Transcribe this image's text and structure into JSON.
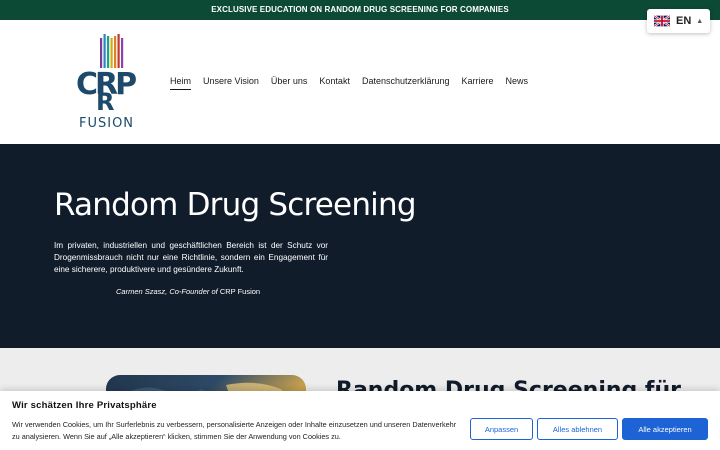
{
  "topbar": {
    "text": "EXCLUSIVE EDUCATION ON RANDOM DRUG SCREENING FOR COMPANIES"
  },
  "language": {
    "code": "EN",
    "flag_icon": "uk-flag-icon"
  },
  "logo": {
    "text": "CRP FUSION",
    "brand_color": "#1d4a6b"
  },
  "nav": {
    "items": [
      {
        "label": "Heim"
      },
      {
        "label": "Unsere Vision"
      },
      {
        "label": "Über uns"
      },
      {
        "label": "Kontakt"
      },
      {
        "label": "Datenschutzerklärung"
      },
      {
        "label": "Karriere"
      },
      {
        "label": "News"
      }
    ]
  },
  "hero": {
    "title": "Random Drug Screening",
    "body": "Im privaten, industriellen und geschäftlichen Bereich ist der Schutz vor Drogenmissbrauch nicht nur eine Richtlinie, sondern ein Engagement für eine sicherere, produktivere und gesündere Zukunft.",
    "cite_name": "Carmen Szasz, Co-Founder of",
    "cite_company": "CRP Fusion"
  },
  "section2": {
    "heading": "Random Drug Screening für"
  },
  "cookie": {
    "title": "Wir schätzen Ihre Privatsphäre",
    "text": "Wir verwenden Cookies, um Ihr Surferlebnis zu verbessern, personalisierte Anzeigen oder Inhalte einzusetzen und unseren Datenverkehr zu analysieren. Wenn Sie auf „Alle akzeptieren“ klicken, stimmen Sie der Anwendung von Cookies zu.",
    "customize_label": "Anpassen",
    "reject_label": "Alles ablehnen",
    "accept_label": "Alle akzeptieren"
  },
  "colors": {
    "topbar": "#0c4a36",
    "hero_bg": "#111c2b",
    "accent": "#1e63d6"
  }
}
